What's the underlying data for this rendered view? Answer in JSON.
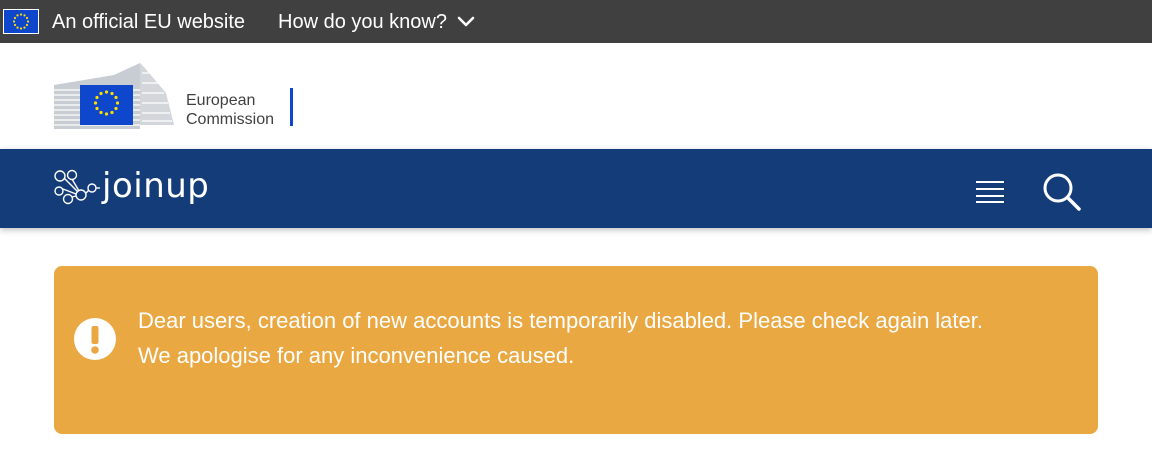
{
  "eu_bar": {
    "official_text": "An official EU website",
    "how_text": "How do you know?"
  },
  "commission": {
    "line1": "European",
    "line2": "Commission"
  },
  "joinup": {
    "logo_text": "joinup"
  },
  "alert": {
    "line1": "Dear users, creation of new accounts is temporarily disabled. Please check again later.",
    "line2": "We apologise for any inconvenience caused."
  },
  "colors": {
    "eu_bar": "#404040",
    "eu_blue": "#0e47cb",
    "joinup_nav": "#143c78",
    "alert": "#eaa843",
    "flag_star": "#ffdd00"
  },
  "icons": {
    "eu_flag": "eu-flag-icon",
    "chevron": "chevron-down-icon",
    "menu": "hamburger-menu-icon",
    "search": "search-icon",
    "alert": "exclamation-icon"
  }
}
